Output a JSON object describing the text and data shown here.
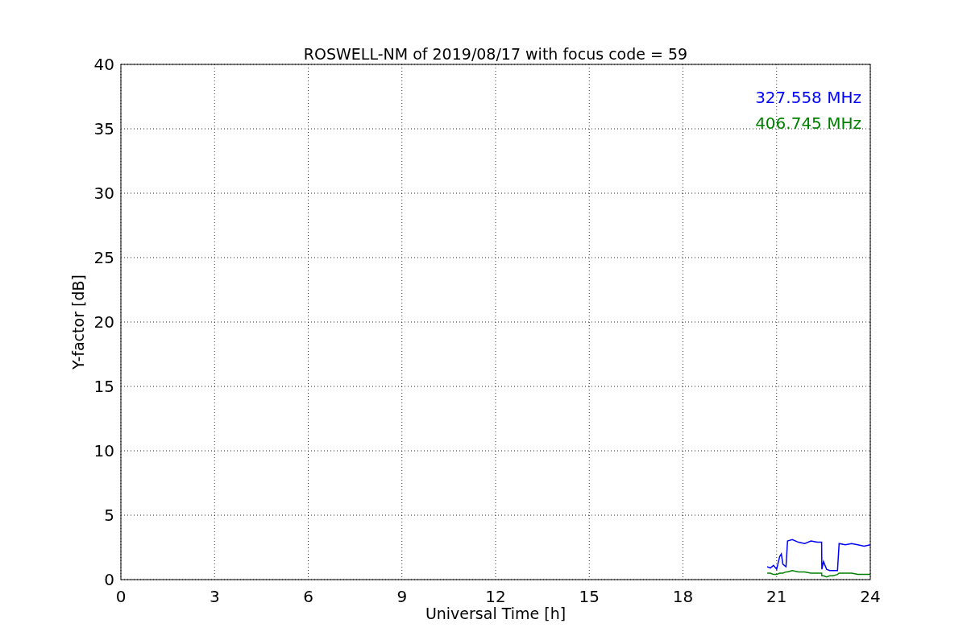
{
  "chart_data": {
    "type": "line",
    "title": "ROSWELL-NM of 2019/08/17 with focus code = 59",
    "xlabel": "Universal Time [h]",
    "ylabel": "Y-factor [dB]",
    "x": [
      20.7,
      20.8,
      20.9,
      21.0,
      21.1,
      21.15,
      21.2,
      21.3,
      21.35,
      21.5,
      21.7,
      21.9,
      22.1,
      22.3,
      22.44,
      22.45,
      22.5,
      22.6,
      22.7,
      22.8,
      22.95,
      23.0,
      23.2,
      23.4,
      23.6,
      23.8,
      24.0
    ],
    "series": [
      {
        "name": "327.558 MHz",
        "color": "#0000ff",
        "values": [
          1.0,
          0.9,
          1.1,
          0.8,
          1.8,
          2.0,
          1.2,
          1.0,
          3.0,
          3.1,
          2.9,
          2.8,
          3.0,
          2.9,
          2.9,
          0.8,
          1.4,
          0.8,
          0.7,
          0.7,
          0.7,
          2.8,
          2.7,
          2.8,
          2.7,
          2.6,
          2.7
        ]
      },
      {
        "name": "406.745 MHz",
        "color": "#008000",
        "values": [
          0.5,
          0.5,
          0.4,
          0.4,
          0.5,
          0.5,
          0.5,
          0.6,
          0.6,
          0.7,
          0.6,
          0.6,
          0.5,
          0.5,
          0.5,
          0.3,
          0.3,
          0.2,
          0.3,
          0.3,
          0.4,
          0.5,
          0.5,
          0.5,
          0.4,
          0.4,
          0.4
        ]
      }
    ],
    "xlim": [
      0,
      24
    ],
    "ylim": [
      0,
      40
    ],
    "xticks": [
      0,
      3,
      6,
      9,
      12,
      15,
      18,
      21,
      24
    ],
    "yticks": [
      0,
      5,
      10,
      15,
      20,
      25,
      30,
      35,
      40
    ],
    "grid": true
  }
}
